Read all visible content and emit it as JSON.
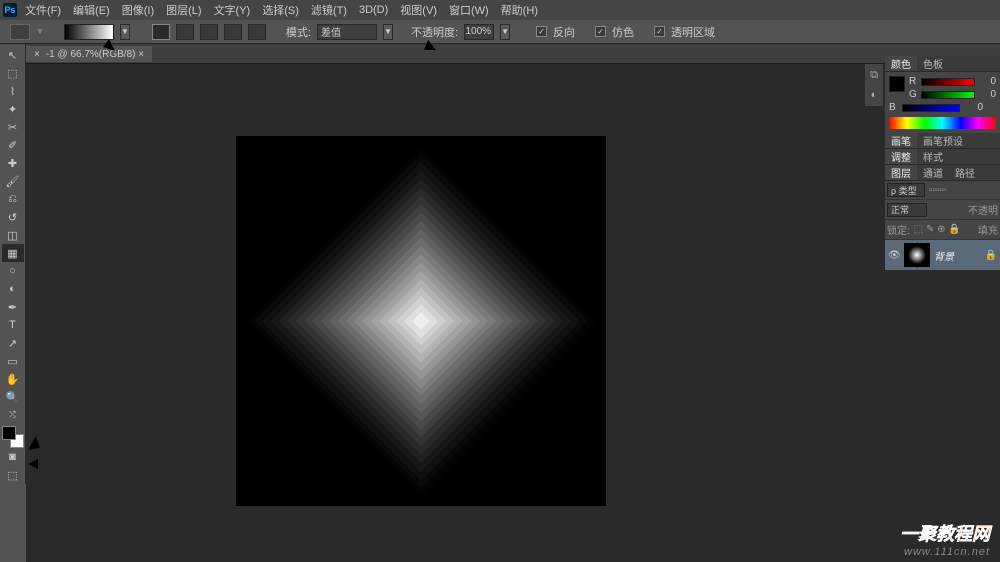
{
  "menu": {
    "items": [
      "文件(F)",
      "编辑(E)",
      "图像(I)",
      "图层(L)",
      "文字(Y)",
      "选择(S)",
      "滤镜(T)",
      "3D(D)",
      "视图(V)",
      "窗口(W)",
      "帮助(H)"
    ]
  },
  "optionsbar": {
    "mode_label": "模式:",
    "mode_value": "差值",
    "opacity_label": "不透明度:",
    "opacity_value": "100%",
    "reverse": "反向",
    "dither": "仿色",
    "transparency": "透明区域"
  },
  "document": {
    "tab_label": "-1 @ 66.7%(RGB/8)  ×"
  },
  "panels": {
    "color": {
      "tab1": "颜色",
      "tab2": "色板",
      "r": "R",
      "g": "G",
      "b": "B",
      "rv": "0",
      "gv": "0",
      "bv": "0"
    },
    "brush": {
      "tab1": "画笔",
      "tab2": "画笔预设"
    },
    "adjust": {
      "tab1": "调整",
      "tab2": "样式"
    },
    "layers": {
      "tab1": "图层",
      "tab2": "通道",
      "tab3": "路径",
      "kind": "ρ 类型",
      "blend": "正常",
      "opacity_label": "不透明",
      "lock_label": "锁定:",
      "fill_label": "填充",
      "bg_layer": "背景"
    }
  },
  "watermark": {
    "title": "一聚教程网",
    "url": "www.111cn.net"
  }
}
